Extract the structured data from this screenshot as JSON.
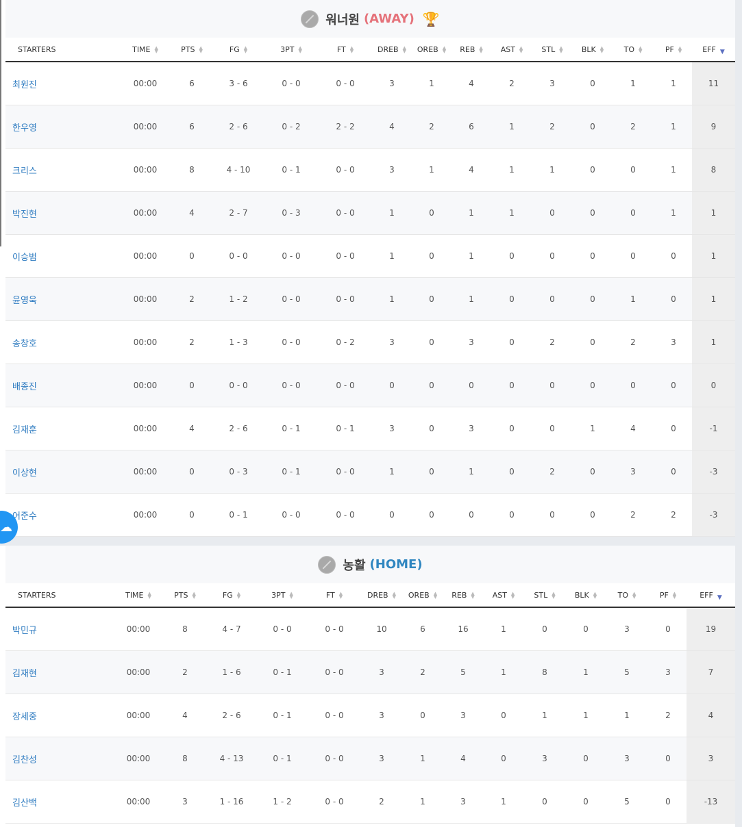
{
  "columns": [
    "STARTERS",
    "TIME",
    "PTS",
    "FG",
    "3PT",
    "FT",
    "DREB",
    "OREB",
    "REB",
    "AST",
    "STL",
    "BLK",
    "TO",
    "PF",
    "EFF"
  ],
  "away": {
    "team_name": "워너원",
    "side": "(AWAY)",
    "winner_icon": "trophy-icon",
    "players": [
      {
        "name": "최원진",
        "stats": [
          "00:00",
          "6",
          "3 - 6",
          "0 - 0",
          "0 - 0",
          "3",
          "1",
          "4",
          "2",
          "3",
          "0",
          "1",
          "1",
          "11"
        ]
      },
      {
        "name": "한우영",
        "stats": [
          "00:00",
          "6",
          "2 - 6",
          "0 - 2",
          "2 - 2",
          "4",
          "2",
          "6",
          "1",
          "2",
          "0",
          "2",
          "1",
          "9"
        ]
      },
      {
        "name": "크리스",
        "stats": [
          "00:00",
          "8",
          "4 - 10",
          "0 - 1",
          "0 - 0",
          "3",
          "1",
          "4",
          "1",
          "1",
          "0",
          "0",
          "1",
          "8"
        ]
      },
      {
        "name": "박진현",
        "stats": [
          "00:00",
          "4",
          "2 - 7",
          "0 - 3",
          "0 - 0",
          "1",
          "0",
          "1",
          "1",
          "0",
          "0",
          "0",
          "1",
          "1"
        ]
      },
      {
        "name": "이승범",
        "stats": [
          "00:00",
          "0",
          "0 - 0",
          "0 - 0",
          "0 - 0",
          "1",
          "0",
          "1",
          "0",
          "0",
          "0",
          "0",
          "0",
          "1"
        ]
      },
      {
        "name": "윤영욱",
        "stats": [
          "00:00",
          "2",
          "1 - 2",
          "0 - 0",
          "0 - 0",
          "1",
          "0",
          "1",
          "0",
          "0",
          "0",
          "1",
          "0",
          "1"
        ]
      },
      {
        "name": "송창호",
        "stats": [
          "00:00",
          "2",
          "1 - 3",
          "0 - 0",
          "0 - 2",
          "3",
          "0",
          "3",
          "0",
          "2",
          "0",
          "2",
          "3",
          "1"
        ]
      },
      {
        "name": "배종진",
        "stats": [
          "00:00",
          "0",
          "0 - 0",
          "0 - 0",
          "0 - 0",
          "0",
          "0",
          "0",
          "0",
          "0",
          "0",
          "0",
          "0",
          "0"
        ]
      },
      {
        "name": "김재훈",
        "stats": [
          "00:00",
          "4",
          "2 - 6",
          "0 - 1",
          "0 - 1",
          "3",
          "0",
          "3",
          "0",
          "0",
          "1",
          "4",
          "0",
          "-1"
        ]
      },
      {
        "name": "이상현",
        "stats": [
          "00:00",
          "0",
          "0 - 3",
          "0 - 1",
          "0 - 0",
          "1",
          "0",
          "1",
          "0",
          "2",
          "0",
          "3",
          "0",
          "-3"
        ]
      },
      {
        "name": "어준수",
        "stats": [
          "00:00",
          "0",
          "0 - 1",
          "0 - 0",
          "0 - 0",
          "0",
          "0",
          "0",
          "0",
          "0",
          "0",
          "2",
          "2",
          "-3"
        ]
      }
    ]
  },
  "home": {
    "team_name": "농활",
    "side": "(HOME)",
    "players": [
      {
        "name": "박민규",
        "stats": [
          "00:00",
          "8",
          "4 - 7",
          "0 - 0",
          "0 - 0",
          "10",
          "6",
          "16",
          "1",
          "0",
          "0",
          "3",
          "0",
          "19"
        ]
      },
      {
        "name": "김재현",
        "stats": [
          "00:00",
          "2",
          "1 - 6",
          "0 - 1",
          "0 - 0",
          "3",
          "2",
          "5",
          "1",
          "8",
          "1",
          "5",
          "3",
          "7"
        ]
      },
      {
        "name": "장세중",
        "stats": [
          "00:00",
          "4",
          "2 - 6",
          "0 - 1",
          "0 - 0",
          "3",
          "0",
          "3",
          "0",
          "1",
          "1",
          "1",
          "2",
          "4"
        ]
      },
      {
        "name": "김찬성",
        "stats": [
          "00:00",
          "8",
          "4 - 13",
          "0 - 1",
          "0 - 0",
          "3",
          "1",
          "4",
          "0",
          "3",
          "0",
          "3",
          "0",
          "3"
        ]
      },
      {
        "name": "김산백",
        "stats": [
          "00:00",
          "3",
          "1 - 16",
          "1 - 2",
          "0 - 0",
          "2",
          "1",
          "3",
          "1",
          "0",
          "0",
          "5",
          "0",
          "-13"
        ]
      }
    ]
  },
  "chat_button_icon": "chat-bubble-icon"
}
